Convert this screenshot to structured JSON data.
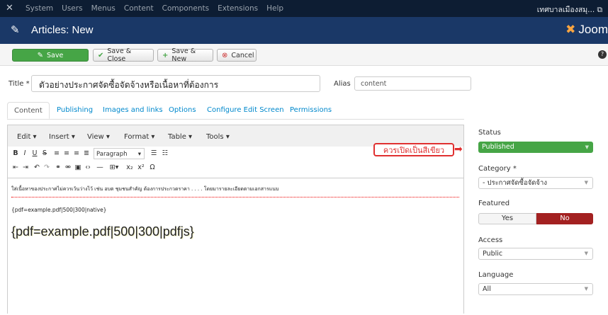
{
  "topbar": {
    "menus": [
      "System",
      "Users",
      "Menus",
      "Content",
      "Components",
      "Extensions",
      "Help"
    ],
    "site_name": "เทศบาลเมืองสมุ... ⧉"
  },
  "header": {
    "title": "Articles: New",
    "brand": "Joom"
  },
  "toolbar": {
    "save": "Save",
    "save_close": "Save & Close",
    "save_new": "Save & New",
    "cancel": "Cancel"
  },
  "form": {
    "title_label": "Title *",
    "title_value": "ตัวอย่างประกาศจัดซื้อจัดจ้างหรือเนื้อหาที่ต้องการ",
    "alias_label": "Alias",
    "alias_value": "content"
  },
  "tabs": [
    "Content",
    "Publishing",
    "Images and links",
    "Options",
    "Configure Edit Screen",
    "Permissions"
  ],
  "editor": {
    "menus": [
      "Edit ▾",
      "Insert ▾",
      "View ▾",
      "Format ▾",
      "Table ▾",
      "Tools ▾"
    ],
    "paragraph": "Paragraph",
    "line1": "ใส่เนื้อหาของประกาศไม่ควรเว้นว่างไว้ เช่น อบต ชุมชนสำคัญ ต้องการประกวดราคา . . . . โดยมารายละเอียดตามเอกสารแนบ",
    "line2": "{pdf=example.pdf|500|300|native}",
    "line3": "{pdf=example.pdf|500|300|pdfjs}"
  },
  "sidebar": {
    "status_label": "Status",
    "status_value": "Published",
    "category_label": "Category *",
    "category_value": "- ประกาศจัดซื้อจัดจ้าง",
    "featured_label": "Featured",
    "yes": "Yes",
    "no": "No",
    "access_label": "Access",
    "access_value": "Public",
    "language_label": "Language",
    "language_value": "All"
  },
  "annotation": "ควรเปิดเป็นสีเขียว"
}
